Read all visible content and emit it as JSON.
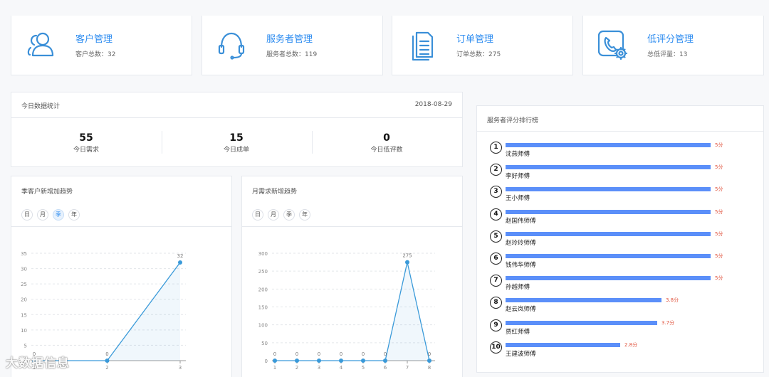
{
  "stats": [
    {
      "title": "客户管理",
      "sub_label": "客户总数：",
      "count": "32",
      "icon": "users-icon"
    },
    {
      "title": "服务者管理",
      "sub_label": "服务者总数：",
      "count": "119",
      "icon": "headset-icon"
    },
    {
      "title": "订单管理",
      "sub_label": "订单总数：",
      "count": "275",
      "icon": "document-icon"
    },
    {
      "title": "低评分管理",
      "sub_label": "总低评量：",
      "count": "13",
      "icon": "phone-gear-icon"
    }
  ],
  "today": {
    "title": "今日数据统计",
    "date": "2018-08-29",
    "items": [
      {
        "value": "55",
        "label": "今日需求"
      },
      {
        "value": "15",
        "label": "今日成单"
      },
      {
        "value": "0",
        "label": "今日低评数"
      }
    ]
  },
  "periods": [
    "日",
    "月",
    "季",
    "年"
  ],
  "quarter_panel": {
    "title": "季客户新增加趋势",
    "active_period": "季"
  },
  "month_panel": {
    "title": "月需求新增趋势",
    "active_period": "季"
  },
  "ranking": {
    "title": "服务者评分排行榜",
    "items": [
      {
        "rank": "1",
        "name": "沈燕师傅",
        "score": 5,
        "score_label": "5分"
      },
      {
        "rank": "2",
        "name": "李好师傅",
        "score": 5,
        "score_label": "5分"
      },
      {
        "rank": "3",
        "name": "王小师傅",
        "score": 5,
        "score_label": "5分"
      },
      {
        "rank": "4",
        "name": "赵国伟师傅",
        "score": 5,
        "score_label": "5分"
      },
      {
        "rank": "5",
        "name": "赵玲玲师傅",
        "score": 5,
        "score_label": "5分"
      },
      {
        "rank": "6",
        "name": "钱伟华师傅",
        "score": 5,
        "score_label": "5分"
      },
      {
        "rank": "7",
        "name": "孙越师傅",
        "score": 5,
        "score_label": "5分"
      },
      {
        "rank": "8",
        "name": "赵云岚师傅",
        "score": 3.8,
        "score_label": "3.8分"
      },
      {
        "rank": "9",
        "name": "贾红师傅",
        "score": 3.7,
        "score_label": "3.7分"
      },
      {
        "rank": "10",
        "name": "王建波师傅",
        "score": 2.8,
        "score_label": "2.8分"
      }
    ]
  },
  "chart_data": [
    {
      "type": "area",
      "x": [
        "1",
        "2",
        "3"
      ],
      "values": [
        0,
        0,
        32
      ],
      "data_labels": [
        "0",
        "0",
        "32"
      ],
      "ylim": [
        0,
        35
      ],
      "yticks": [
        "0",
        "5",
        "10",
        "15",
        "20",
        "25",
        "30",
        "35"
      ],
      "grid": true
    },
    {
      "type": "area",
      "x": [
        "1",
        "2",
        "3",
        "4",
        "5",
        "6",
        "7",
        "8"
      ],
      "values": [
        0,
        0,
        0,
        0,
        0,
        0,
        275,
        0
      ],
      "data_labels": [
        "0",
        "0",
        "0",
        "0",
        "0",
        "0",
        "275",
        "0"
      ],
      "ylim": [
        0,
        300
      ],
      "yticks": [
        "0",
        "50",
        "100",
        "150",
        "200",
        "250",
        "300"
      ],
      "grid": true
    }
  ],
  "watermark": "大数据信息",
  "colors": {
    "accent": "#2d8cf0",
    "line": "#3a9ad9",
    "bar": "#5b8ff9",
    "score": "#e0533d"
  }
}
